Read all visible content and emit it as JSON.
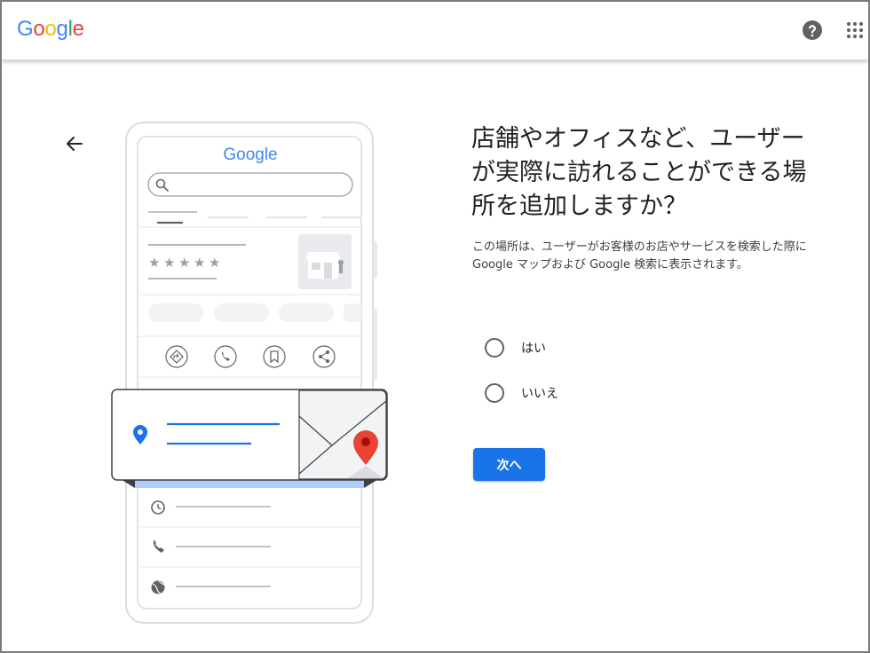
{
  "header": {
    "logo_letters": [
      "G",
      "o",
      "o",
      "g",
      "l",
      "e"
    ],
    "logo_colors": [
      "#4285f4",
      "#ea4335",
      "#fbbc05",
      "#4285f4",
      "#34a853",
      "#ea4335"
    ],
    "help_icon": "help-circle-icon",
    "apps_icon": "apps-grid-icon"
  },
  "nav": {
    "back_icon": "arrow-back-icon"
  },
  "illustration": {
    "logo_text": "Google",
    "elements": [
      "search-bar",
      "star-rating",
      "storefront-image",
      "directions-icon",
      "phone-icon",
      "bookmark-icon",
      "share-icon",
      "location-pin-icon",
      "map-marker-icon",
      "clock-icon",
      "globe-icon"
    ]
  },
  "main": {
    "title": "店舗やオフィスなど、ユーザーが実際に訪れることができる場所を追加しますか？",
    "description": "この場所は、ユーザーがお客様のお店やサービスを検索した際に Google マップおよび Google 検索に表示されます。",
    "options": [
      {
        "label": "はい",
        "selected": false
      },
      {
        "label": "いいえ",
        "selected": false
      }
    ],
    "next_label": "次へ"
  },
  "colors": {
    "accent": "#1a73e8",
    "text_primary": "#202124",
    "icon_gray": "#5f6368"
  }
}
